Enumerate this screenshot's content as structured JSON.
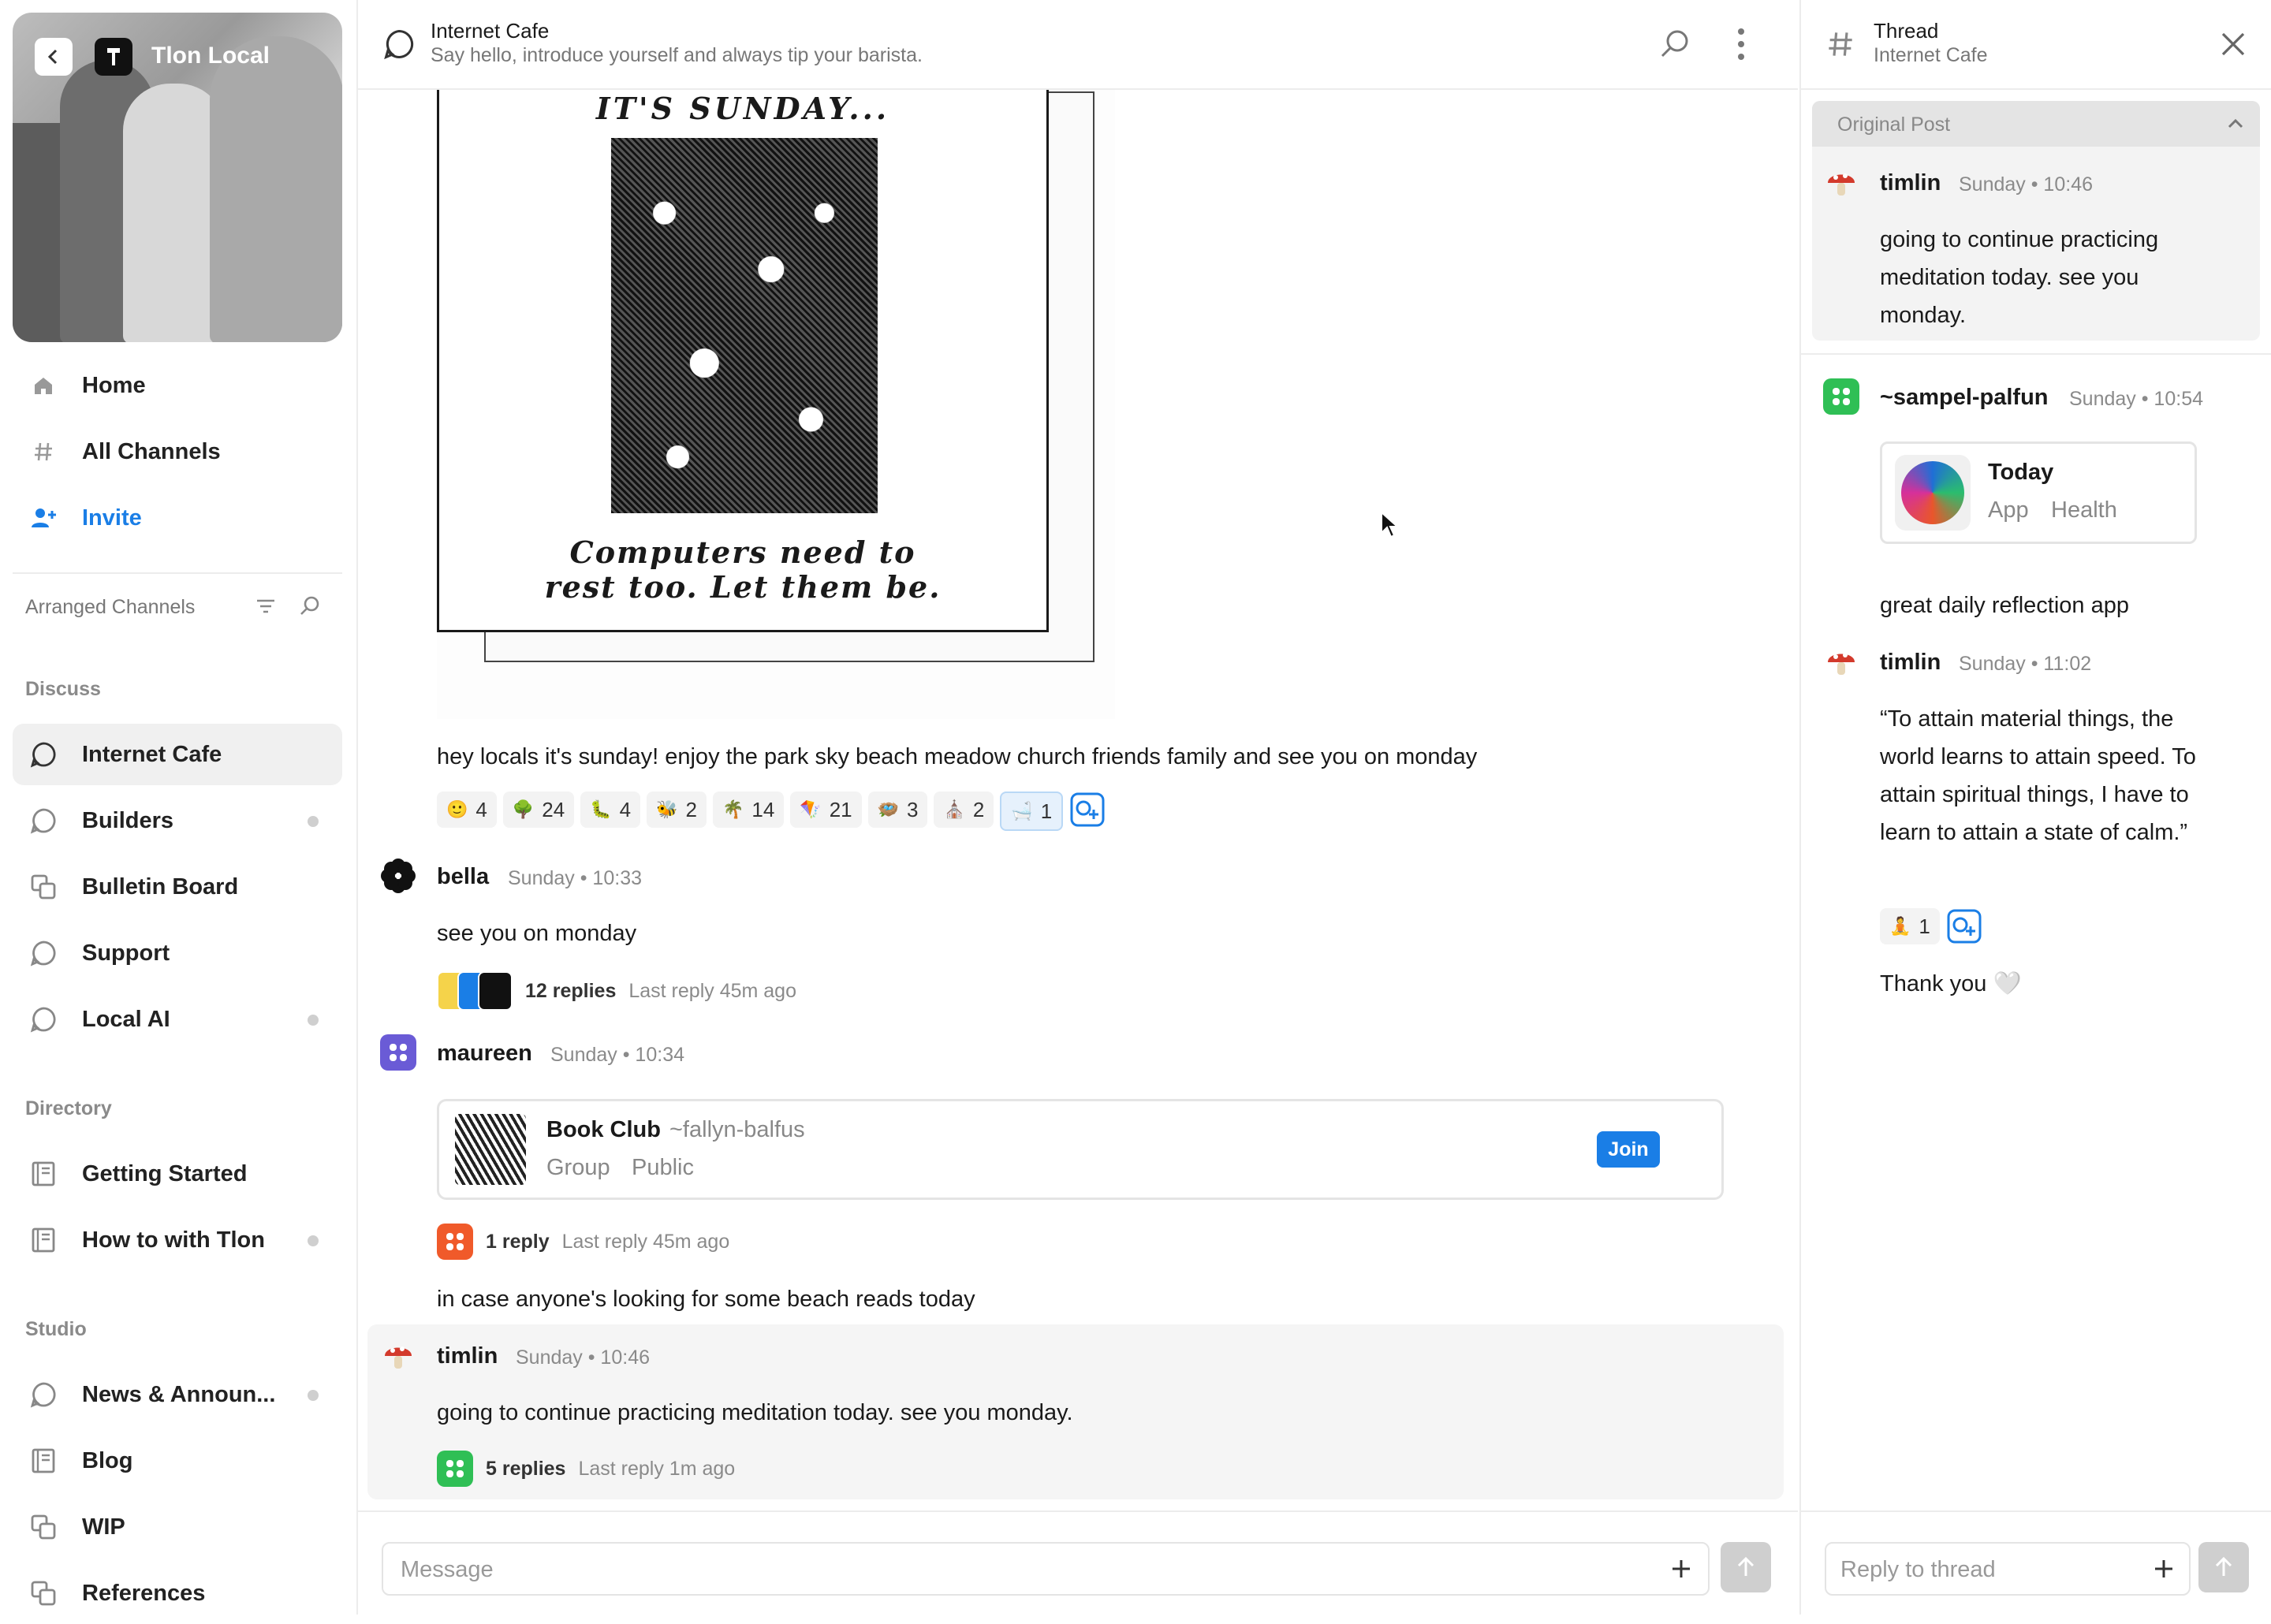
{
  "sidebar": {
    "group_name": "Tlon Local",
    "nav": [
      {
        "label": "Home",
        "icon": "home-icon"
      },
      {
        "label": "All Channels",
        "icon": "hash-icon"
      },
      {
        "label": "Invite",
        "icon": "add-person-icon"
      }
    ],
    "arranged_label": "Arranged Channels",
    "sections": [
      {
        "title": "Discuss",
        "channels": [
          {
            "label": "Internet Cafe",
            "unread": false,
            "active": true
          },
          {
            "label": "Builders",
            "unread": true
          },
          {
            "label": "Bulletin Board",
            "unread": false
          },
          {
            "label": "Support",
            "unread": false
          },
          {
            "label": "Local AI",
            "unread": true
          }
        ]
      },
      {
        "title": "Directory",
        "channels": [
          {
            "label": "Getting Started",
            "unread": false
          },
          {
            "label": "How to with Tlon",
            "unread": true
          }
        ]
      },
      {
        "title": "Studio",
        "channels": [
          {
            "label": "News & Announ...",
            "unread": true
          },
          {
            "label": "Blog",
            "unread": false
          },
          {
            "label": "WIP",
            "unread": false
          },
          {
            "label": "References",
            "unread": false
          }
        ]
      }
    ]
  },
  "channel": {
    "title": "Internet Cafe",
    "description": "Say hello, introduce yourself and always tip your barista."
  },
  "poster": {
    "heading": "IT'S SUNDAY...",
    "caption_line1": "Computers need to",
    "caption_line2": "rest too. Let them be."
  },
  "messages": {
    "sunday_post": {
      "text": "hey locals it's sunday! enjoy the park sky beach meadow church friends family and see you on monday",
      "reactions": [
        {
          "emoji": "🙂",
          "count": "4"
        },
        {
          "emoji": "🌳",
          "count": "24"
        },
        {
          "emoji": "🐛",
          "count": "4"
        },
        {
          "emoji": "🐝",
          "count": "2"
        },
        {
          "emoji": "🌴",
          "count": "14"
        },
        {
          "emoji": "🪁",
          "count": "21"
        },
        {
          "emoji": "🪺",
          "count": "3"
        },
        {
          "emoji": "⛪",
          "count": "2"
        },
        {
          "emoji": "🛁",
          "count": "1"
        }
      ]
    },
    "bella": {
      "author": "bella",
      "time": "Sunday • 10:33",
      "text": "see you on monday",
      "replies": "12 replies",
      "last_reply": "Last reply 45m ago"
    },
    "maureen": {
      "author": "maureen",
      "time": "Sunday • 10:34",
      "card": {
        "title": "Book Club",
        "host": "~fallyn-balfus",
        "tag1": "Group",
        "tag2": "Public",
        "join": "Join"
      },
      "replies": "1 reply",
      "last_reply": "Last reply 45m ago",
      "text": "in case anyone's looking for some beach reads today"
    },
    "timlin": {
      "author": "timlin",
      "time": "Sunday • 10:46",
      "text": "going to continue practicing meditation today. see you monday.",
      "replies": "5 replies",
      "last_reply": "Last reply 1m ago"
    }
  },
  "composer": {
    "placeholder": "Message"
  },
  "thread": {
    "title": "Thread",
    "subtitle": "Internet Cafe",
    "original_label": "Original Post",
    "op": {
      "author": "timlin",
      "time": "Sunday • 10:46",
      "text": "going to continue practicing meditation today. see you monday."
    },
    "reply1": {
      "author": "~sampel-palfun",
      "time": "Sunday • 10:54",
      "card": {
        "name": "Today",
        "tag1": "App",
        "tag2": "Health"
      },
      "text": "great daily reflection app"
    },
    "reply2": {
      "author": "timlin",
      "time": "Sunday • 11:02",
      "text": "“To attain material things, the world learns to attain speed. To attain spiritual things, I have to learn to attain a state of calm.”",
      "reaction": {
        "emoji": "🧘",
        "count": "1"
      },
      "followup": "Thank you 🤍"
    },
    "composer_placeholder": "Reply to thread"
  },
  "colors": {
    "accent": "#1a7ee6",
    "unread_dot": "#cfcfcf",
    "green_avatar": "#2fbf55",
    "purple_avatar": "#6a5bd6",
    "orange_avatar": "#f05a2a"
  }
}
